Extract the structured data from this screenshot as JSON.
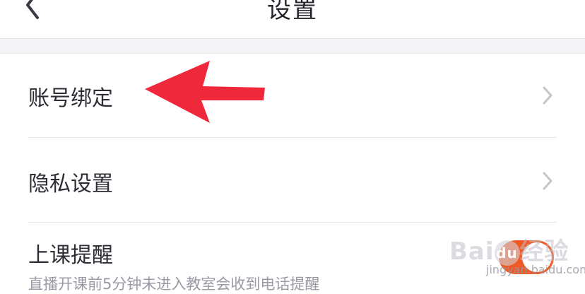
{
  "header": {
    "title": "设置"
  },
  "settings": {
    "items": [
      {
        "label": "账号绑定"
      },
      {
        "label": "隐私设置"
      },
      {
        "label": "上课提醒",
        "sub": "直播开课前5分钟未进入教室会收到电话提醒",
        "toggle_on": true
      }
    ]
  },
  "watermark": {
    "logo": "Bai",
    "logo_du": "du",
    "logo_suffix": "经验",
    "url": "jingyan.baidu.com"
  },
  "colors": {
    "arrow": "#f0283c",
    "toggle": "#f15a24",
    "accent_text": "#2d2d35"
  }
}
